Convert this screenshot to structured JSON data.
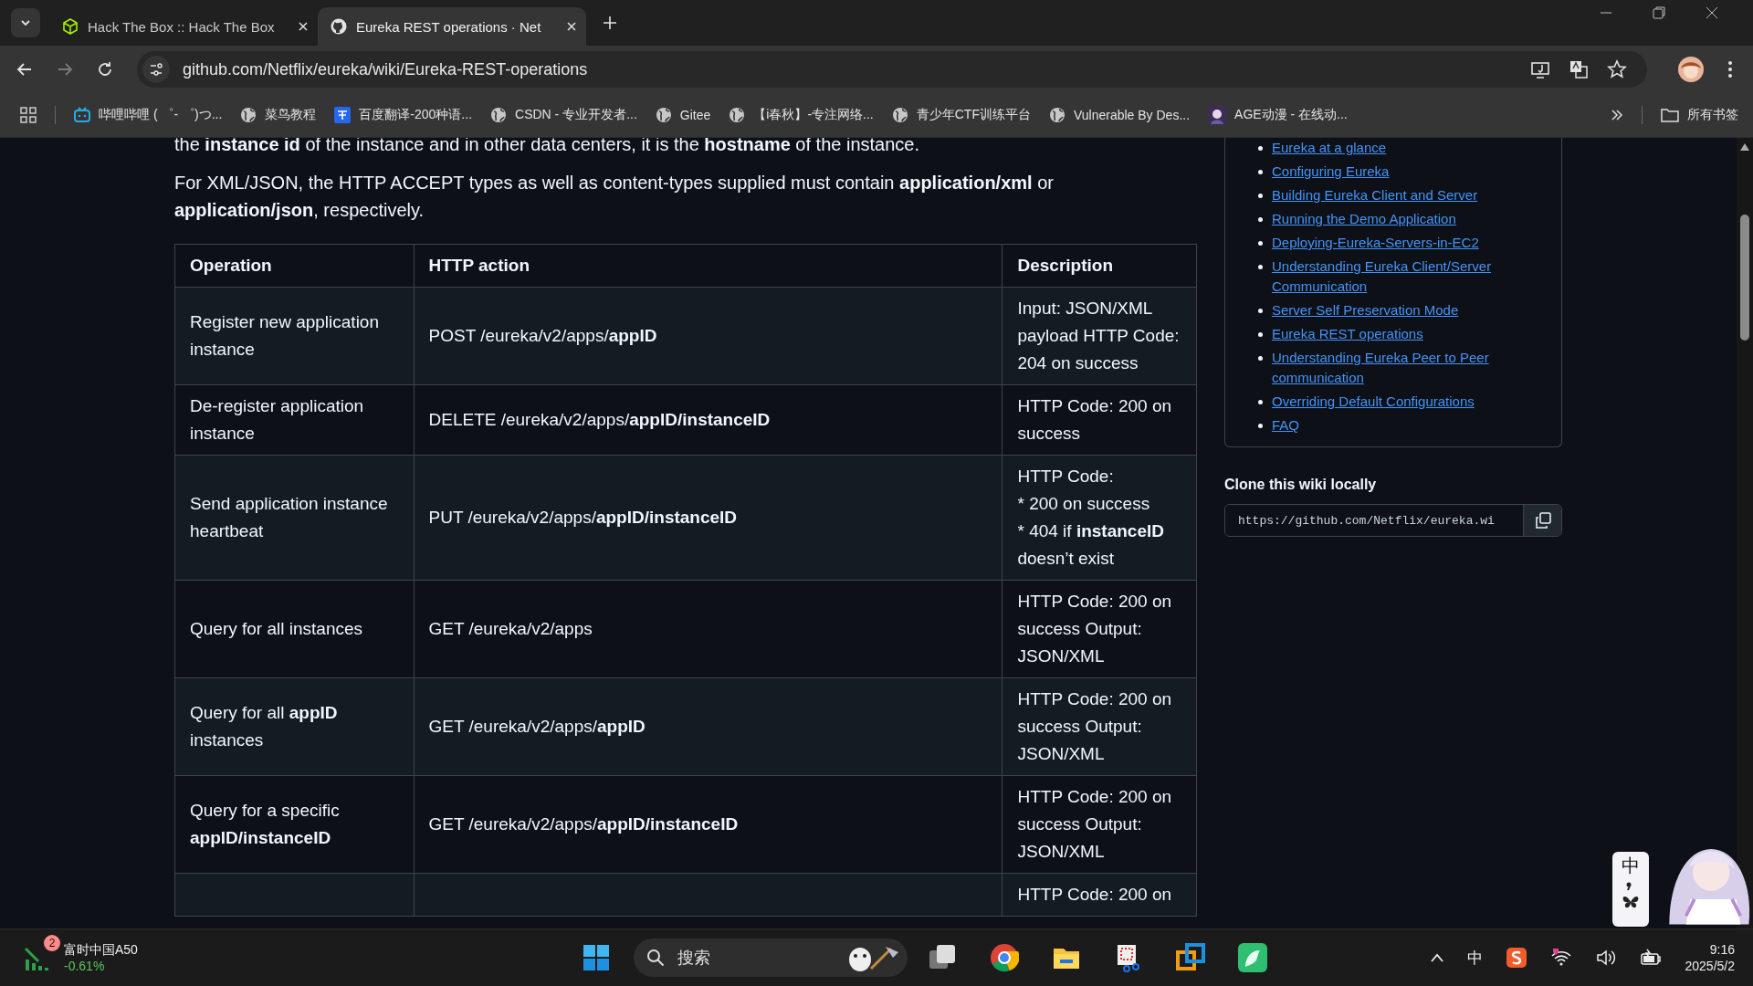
{
  "browser": {
    "tabs": [
      {
        "title": "Hack The Box :: Hack The Box",
        "selected": false
      },
      {
        "title": "Eureka REST operations · Net",
        "selected": true
      }
    ],
    "url": "github.com/Netflix/eureka/wiki/Eureka-REST-operations",
    "bookmarks": [
      {
        "label": "哔哩哔哩 ( ゜- ゜)つ..."
      },
      {
        "label": "菜鸟教程"
      },
      {
        "label": "百度翻译-200种语..."
      },
      {
        "label": "CSDN - 专业开发者..."
      },
      {
        "label": "Gitee"
      },
      {
        "label": "【i春秋】-专注网络..."
      },
      {
        "label": "青少年CTF训练平台"
      },
      {
        "label": "Vulnerable By Des..."
      },
      {
        "label": "AGE动漫 - 在线动..."
      }
    ],
    "all_bookmarks": "所有书签"
  },
  "article": {
    "paragraphs": [
      "the **instance id** of the instance and in other data centers, it is the **hostname** of the instance.",
      "For XML/JSON, the HTTP ACCEPT types as well as content-types supplied must contain **application/xml** or **application/json**, respectively."
    ],
    "table": {
      "columns": [
        "Operation",
        "HTTP action",
        "Description"
      ],
      "rows": [
        {
          "operation": "Register new application instance",
          "action": "POST /eureka/v2/apps/**appID**",
          "description": "Input: JSON/XML payload HTTP Code: 204 on success"
        },
        {
          "operation": "De-register application instance",
          "action": "DELETE /eureka/v2/apps/**appID/instanceID**",
          "description": "HTTP Code: 200 on success"
        },
        {
          "operation": "Send application instance heartbeat",
          "action": "PUT /eureka/v2/apps/**appID/instanceID**",
          "description": "HTTP Code:\n* 200 on success\n* 404 if **instanceID** doesn’t exist"
        },
        {
          "operation": "Query for all instances",
          "action": "GET /eureka/v2/apps",
          "description": "HTTP Code: 200 on success Output: JSON/XML"
        },
        {
          "operation": "Query for all **appID** instances",
          "action": "GET /eureka/v2/apps/**appID**",
          "description": "HTTP Code: 200 on success Output: JSON/XML"
        },
        {
          "operation": "Query for a specific **appID/instanceID**",
          "action": "GET /eureka/v2/apps/**appID/instanceID**",
          "description": "HTTP Code: 200 on success Output: JSON/XML"
        },
        {
          "description": "HTTP Code: 200 on"
        }
      ]
    }
  },
  "sidebar": {
    "pages": [
      {
        "label": "Eureka at a glance"
      },
      {
        "label": "Configuring Eureka"
      },
      {
        "label": "Building Eureka Client and Server"
      },
      {
        "label": "Running the Demo Application"
      },
      {
        "label": "Deploying-Eureka-Servers-in-EC2"
      },
      {
        "label": "Understanding Eureka Client/Server Communication"
      },
      {
        "label": "Server Self Preservation Mode"
      },
      {
        "label": "Eureka REST operations"
      },
      {
        "label": "Understanding Eureka Peer to Peer communication"
      },
      {
        "label": "Overriding Default Configurations"
      },
      {
        "label": "FAQ"
      }
    ],
    "clone_title": "Clone this wiki locally",
    "clone_url": "https://github.com/Netflix/eureka.wi"
  },
  "ime_panel": {
    "label": "中"
  },
  "taskbar": {
    "widget": {
      "badge": "2",
      "name": "富时中国A50",
      "change": "-0.61%"
    },
    "search_placeholder": "搜索",
    "tray": {
      "ime": "中",
      "time": "9:16",
      "date": "2025/5/2"
    }
  }
}
